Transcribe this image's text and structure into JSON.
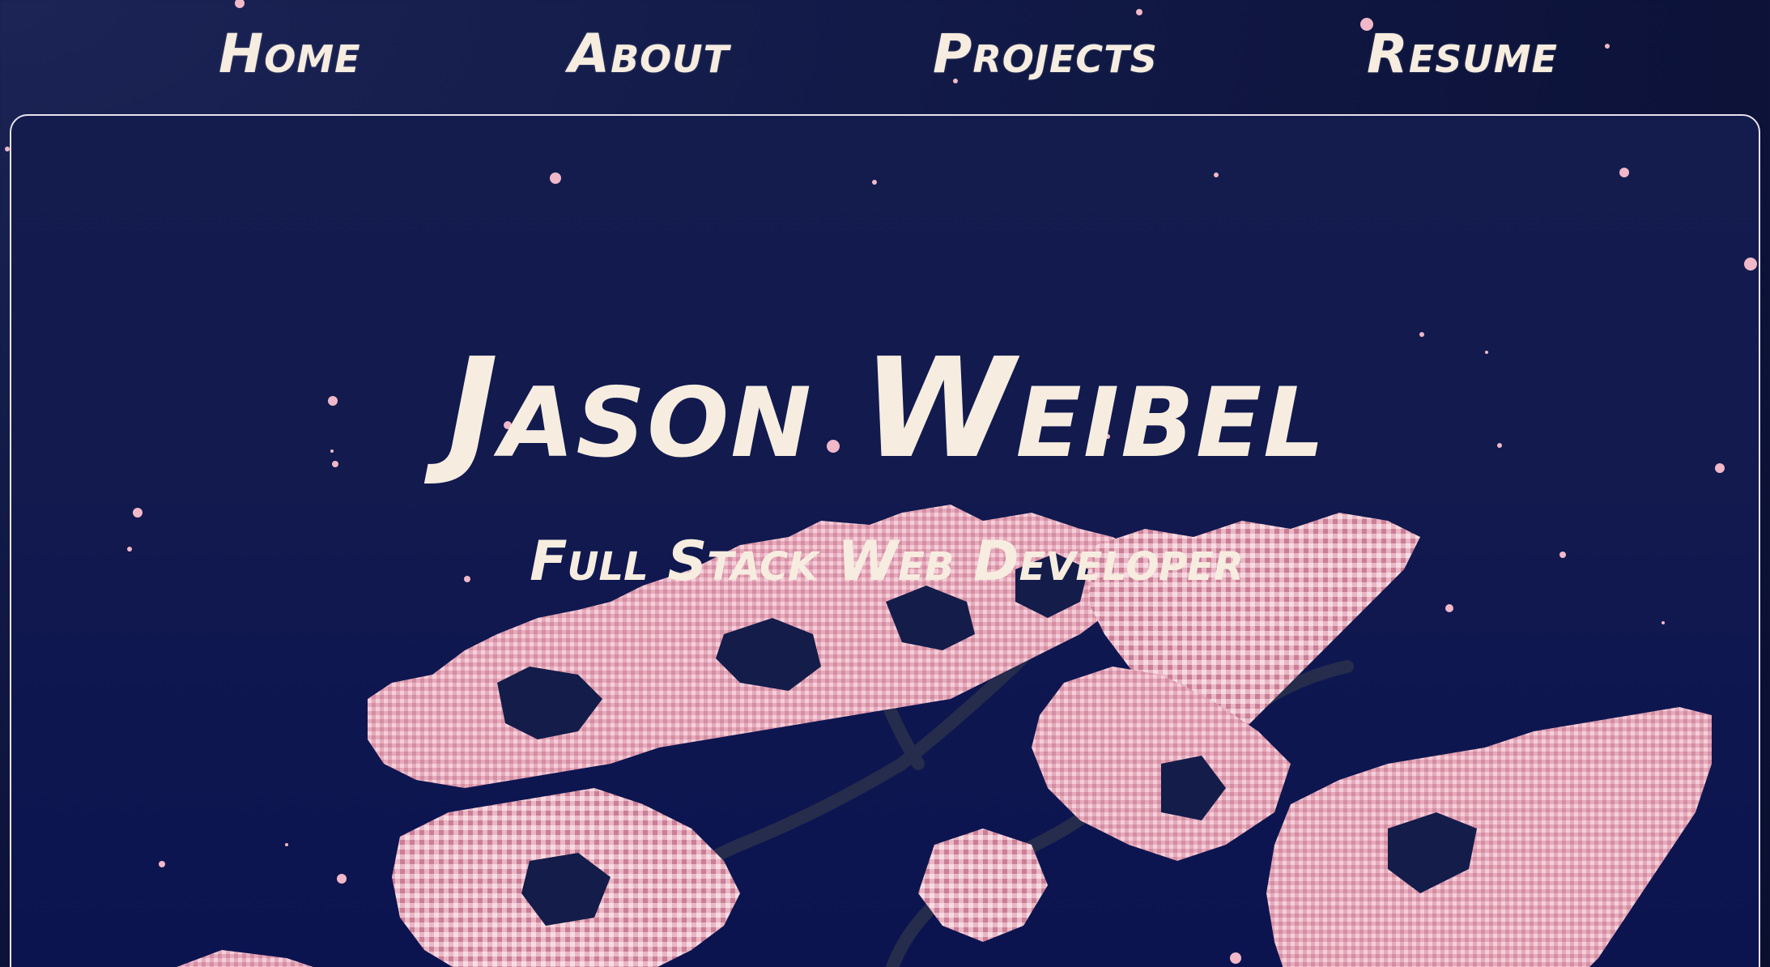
{
  "nav": {
    "items": [
      {
        "label": "Home"
      },
      {
        "label": "About"
      },
      {
        "label": "Projects"
      },
      {
        "label": "Resume"
      }
    ]
  },
  "hero": {
    "name": "Jason Weibel",
    "tagline": "Full Stack Web Developer"
  },
  "colors": {
    "background": "#121a48",
    "text": "#f6ede0",
    "frame_border": "#e8e2ee",
    "blossom_light": "#f2c9d6",
    "blossom_mid": "#e09aae",
    "blossom_dark": "#b86d84",
    "branch": "#232a4a",
    "star": "#f0b8c8"
  },
  "illustration": {
    "icon": "cherry-blossom-tree-pixel-art"
  }
}
